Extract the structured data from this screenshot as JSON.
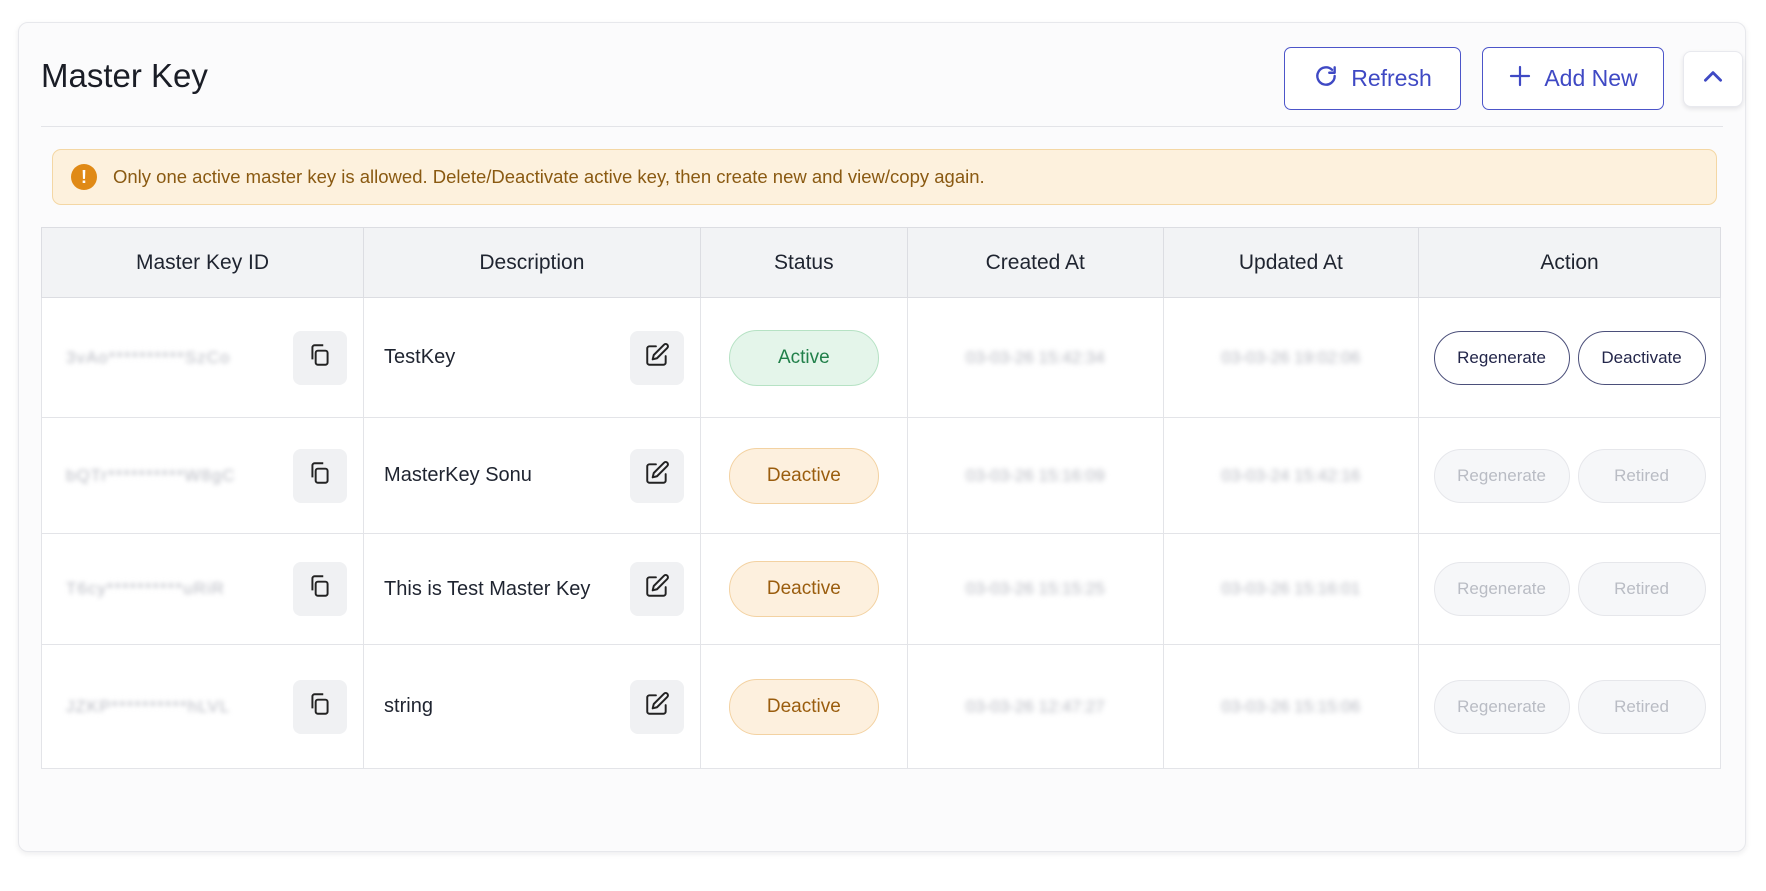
{
  "header": {
    "title": "Master Key",
    "refresh_label": "Refresh",
    "add_label": "Add New"
  },
  "alert": {
    "text": "Only one active master key is allowed. Delete/Deactivate active key, then create new and view/copy again."
  },
  "table": {
    "columns": [
      "Master Key ID",
      "Description",
      "Status",
      "Created At",
      "Updated At",
      "Action"
    ],
    "rows": [
      {
        "key": "3vAo**********SzCo",
        "description": "TestKey",
        "status": "Active",
        "created": "03-03-26 15:42:34",
        "updated": "03-03-26 19:02:06",
        "regenerate": "Regenerate",
        "second_action": "Deactivate"
      },
      {
        "key": "bQTr**********W8gC",
        "description": "MasterKey Sonu",
        "status": "Deactive",
        "created": "03-03-26 15:16:09",
        "updated": "03-03-24 15:42:16",
        "regenerate": "Regenerate",
        "second_action": "Retired"
      },
      {
        "key": "T6cy**********uRiR",
        "description": "This is Test Master Key",
        "status": "Deactive",
        "created": "03-03-26 15:15:25",
        "updated": "03-03-26 15:16:01",
        "regenerate": "Regenerate",
        "second_action": "Retired"
      },
      {
        "key": "JZKP**********hLVL",
        "description": "string",
        "status": "Deactive",
        "created": "03-03-26 12:47:27",
        "updated": "03-03-26 15:15:06",
        "regenerate": "Regenerate",
        "second_action": "Retired"
      }
    ]
  },
  "colors": {
    "accent": "#3f49c4",
    "active_green": "#21804a",
    "deactive_orange": "#9a5d0e",
    "warning_bg": "#fdf1dd"
  },
  "icons": {
    "refresh": "refresh-icon",
    "add": "plus-icon",
    "collapse": "chevron-up-icon",
    "warning": "exclamation-circle-icon",
    "copy": "copy-icon",
    "edit": "edit-icon"
  }
}
